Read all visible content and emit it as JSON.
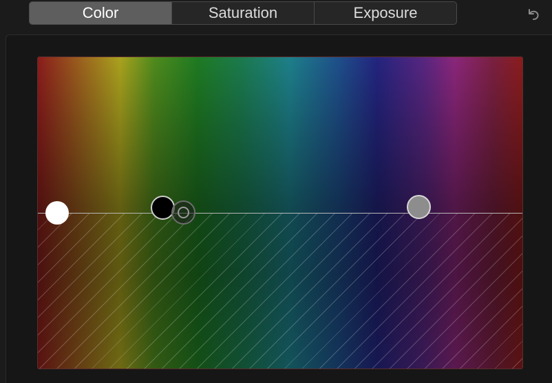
{
  "tabs": [
    {
      "label": "Color",
      "active": true
    },
    {
      "label": "Saturation",
      "active": false
    },
    {
      "label": "Exposure",
      "active": false
    }
  ],
  "toolbar": {
    "undo_icon": "undo-icon"
  },
  "board": {
    "handles": [
      "highlights-white",
      "midtones-black",
      "shadows-gray",
      "global-neutral"
    ]
  },
  "colors": {
    "active_tab": "#5e5e5e",
    "background": "#1b1b1b"
  }
}
